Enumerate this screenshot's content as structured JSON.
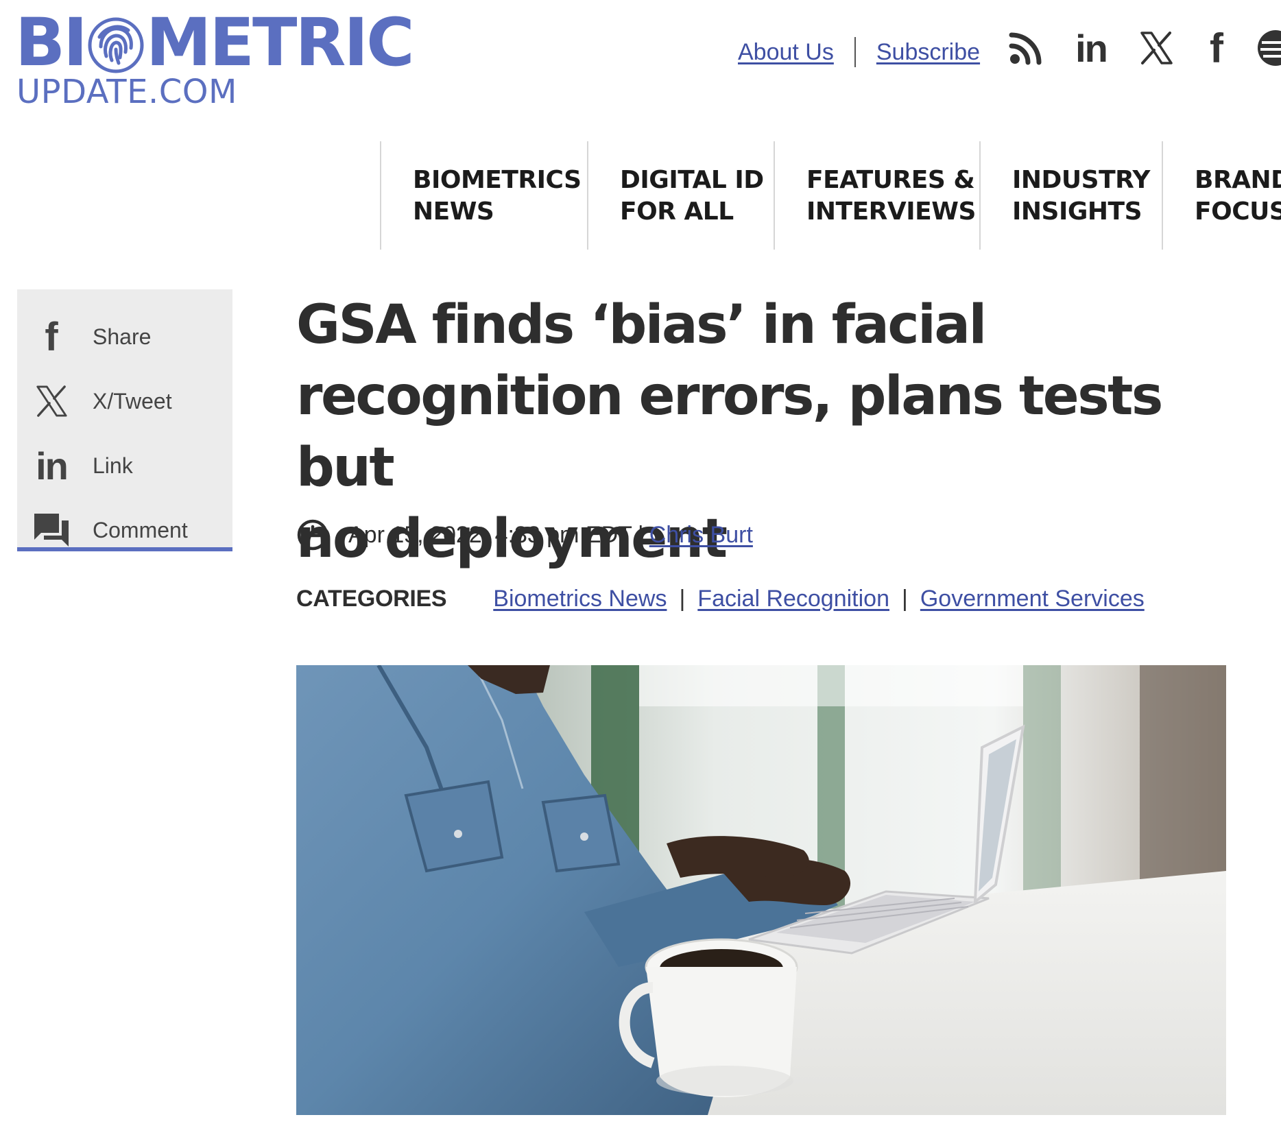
{
  "site": {
    "logo_top_left": "BI",
    "logo_top_right": "METRIC",
    "logo_bottom": "UPDATE.COM"
  },
  "top_links": {
    "about": "About Us",
    "subscribe": "Subscribe"
  },
  "social_icons": [
    "rss-icon",
    "linkedin-icon",
    "x-icon",
    "facebook-icon",
    "more-icon"
  ],
  "social_text": {
    "linkedin": "in",
    "facebook": "f"
  },
  "nav": [
    {
      "line1": "BIOMETRICS",
      "line2": "NEWS"
    },
    {
      "line1": "DIGITAL ID",
      "line2": "FOR ALL"
    },
    {
      "line1": "FEATURES &",
      "line2": "INTERVIEWS"
    },
    {
      "line1": "INDUSTRY",
      "line2": "INSIGHTS"
    },
    {
      "line1": "BRAND",
      "line2": "FOCUS"
    }
  ],
  "share": [
    {
      "icon": "facebook-icon",
      "label": "Share"
    },
    {
      "icon": "x-icon",
      "label": "X/Tweet"
    },
    {
      "icon": "linkedin-icon",
      "label": "Link"
    },
    {
      "icon": "comment-icon",
      "label": "Comment"
    }
  ],
  "share_icon_text": {
    "facebook": "f",
    "linkedin": "in"
  },
  "article": {
    "headline_line1": "GSA finds ‘bias’ in facial",
    "headline_line2": "recognition errors, plans tests but",
    "headline_line3": "no deployment",
    "date": "Apr 15, 2022, 4:33 pm EDT",
    "date_sep": "|",
    "author": "Chris Burt",
    "categories_label": "CATEGORIES",
    "categories": [
      "Biometrics News",
      "Facial Recognition",
      "Government Services"
    ],
    "category_sep": "|"
  },
  "colors": {
    "brand": "#5b6fc0",
    "link": "#3e4fa3",
    "sidebar_bg": "#ececec"
  }
}
